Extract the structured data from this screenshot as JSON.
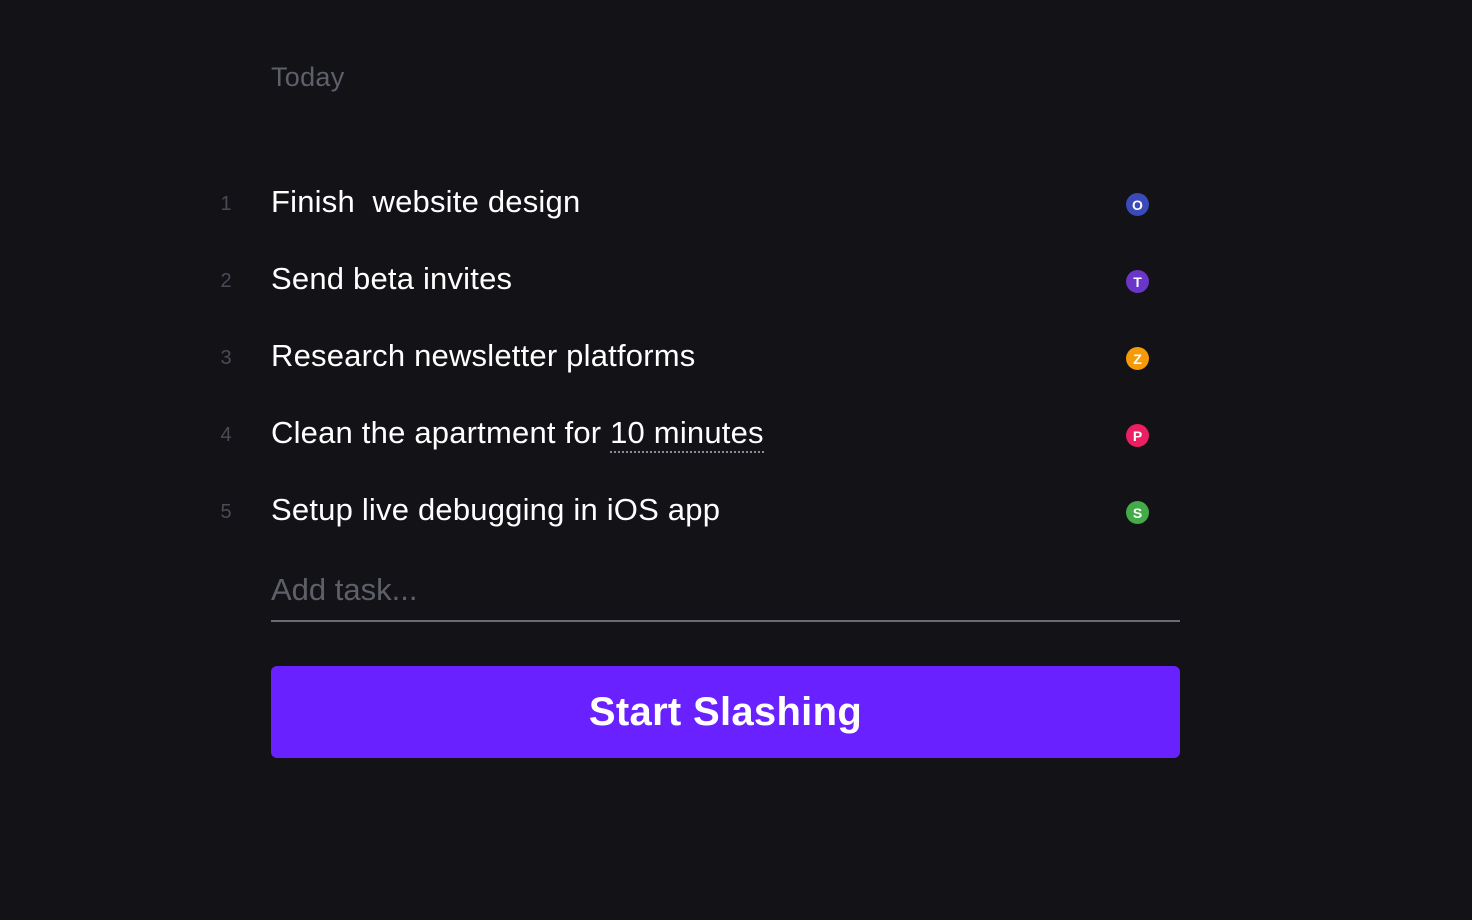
{
  "heading": "Today",
  "tasks": [
    {
      "num": "1",
      "text": "Finish  website design",
      "time": "",
      "avatar": "O",
      "avatar_color": "#3a4ab8"
    },
    {
      "num": "2",
      "text": "Send beta invites",
      "time": "",
      "avatar": "T",
      "avatar_color": "#6a35c9"
    },
    {
      "num": "3",
      "text": "Research newsletter platforms",
      "time": "",
      "avatar": "Z",
      "avatar_color": "#f59a0a"
    },
    {
      "num": "4",
      "text": "Clean the apartment for ",
      "time": "10 minutes",
      "avatar": "P",
      "avatar_color": "#ec1f63"
    },
    {
      "num": "5",
      "text": "Setup live debugging in iOS app",
      "time": "",
      "avatar": "S",
      "avatar_color": "#43ac48"
    }
  ],
  "add_task": {
    "placeholder": "Add task...",
    "value": ""
  },
  "start_button": {
    "label": "Start Slashing",
    "color": "#6a21ff"
  }
}
